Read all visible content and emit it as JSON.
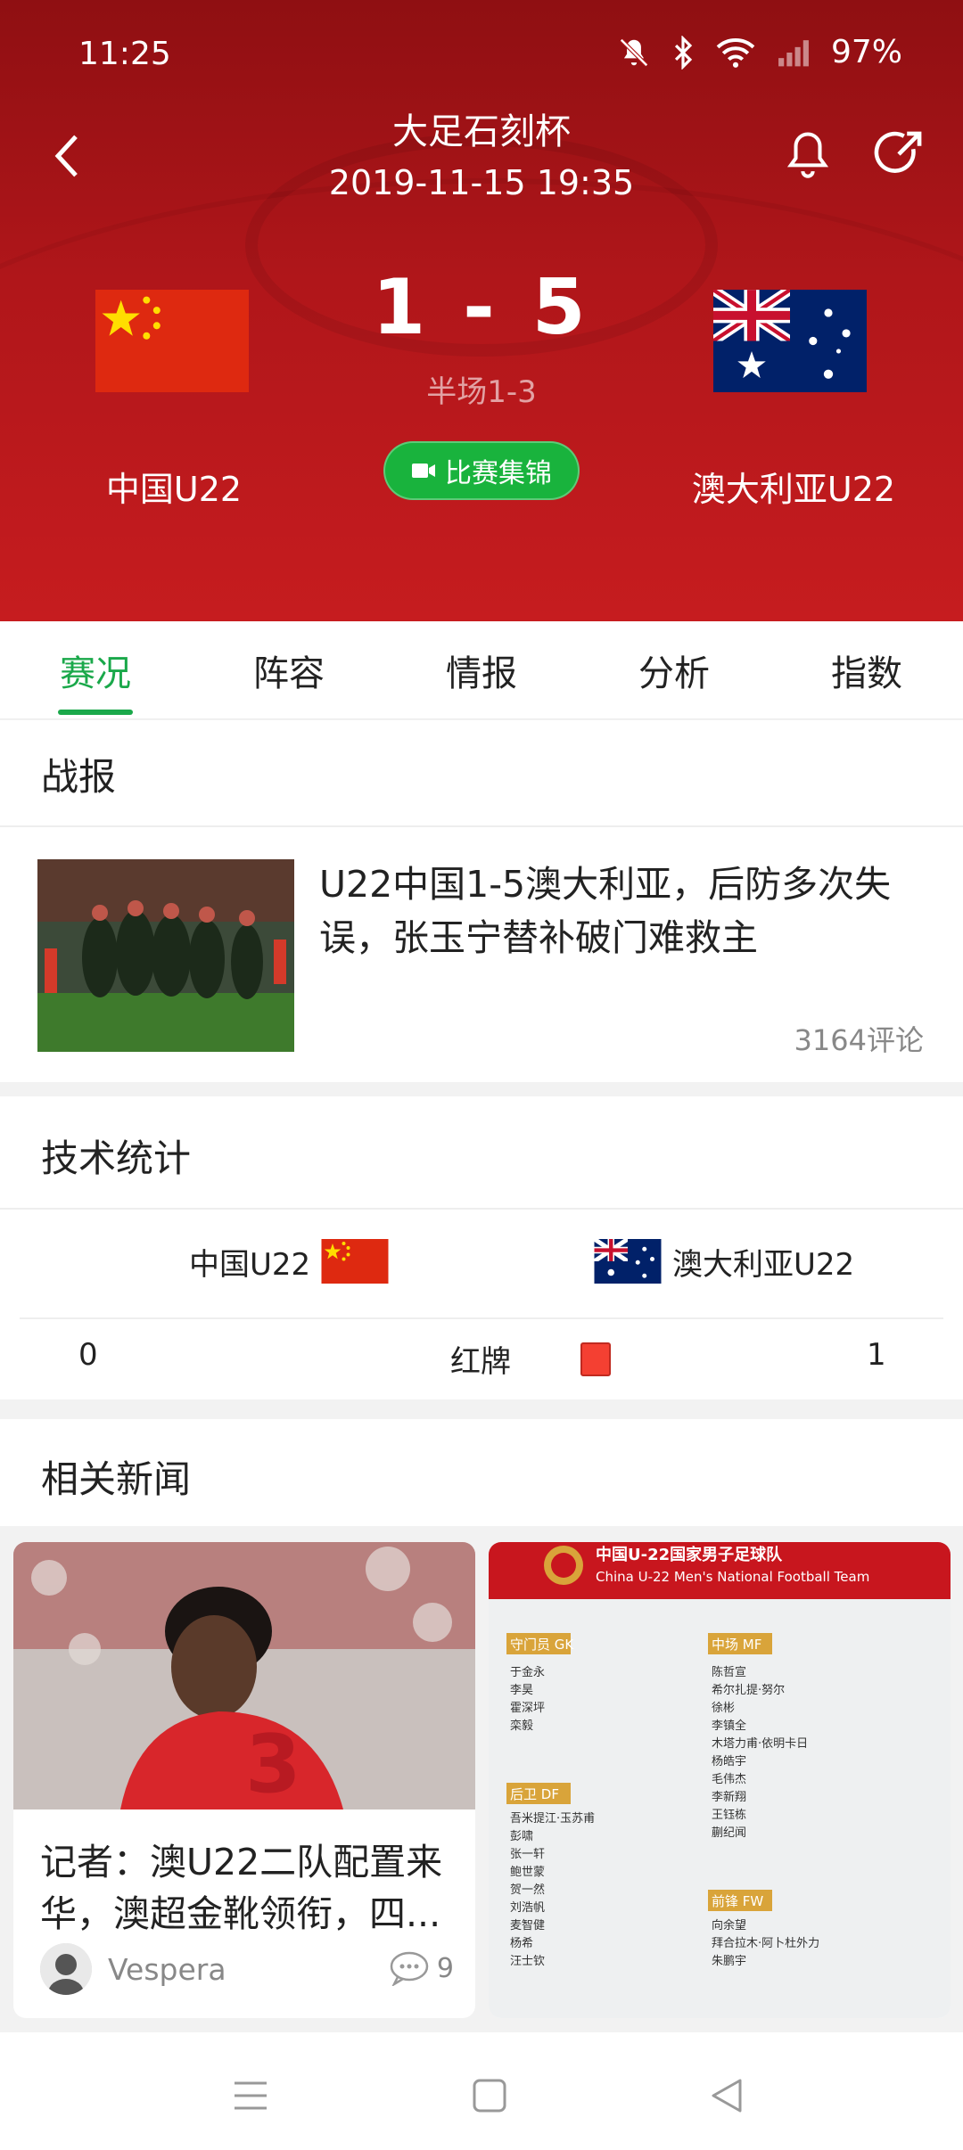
{
  "status_bar": {
    "time": "11:25",
    "battery": "97%"
  },
  "header": {
    "title": "大足石刻杯",
    "datetime": "2019-11-15 19:35",
    "score": "1 - 5",
    "halftime": "半场1-3",
    "home_team": "中国U22",
    "away_team": "澳大利亚U22",
    "highlight_label": "比赛集锦"
  },
  "tabs": [
    {
      "label": "赛况",
      "active": true
    },
    {
      "label": "阵容",
      "active": false
    },
    {
      "label": "情报",
      "active": false
    },
    {
      "label": "分析",
      "active": false
    },
    {
      "label": "指数",
      "active": false
    }
  ],
  "report": {
    "section_title": "战报",
    "headline": "U22中国1-5澳大利亚，后防多次失误，张玉宁替补破门难救主",
    "comments": "3164评论"
  },
  "stats": {
    "section_title": "技术统计",
    "home_team": "中国U22",
    "away_team": "澳大利亚U22",
    "rows": [
      {
        "label": "红牌",
        "home": "0",
        "away": "1"
      }
    ]
  },
  "related": {
    "section_title": "相关新闻",
    "cards": [
      {
        "title": "记者：澳U22二队配置来华，澳超金靴领衔，四...",
        "author": "Vespera",
        "comments": "9"
      },
      {
        "poster_title": "中国U-22国家男子足球队",
        "poster_subtitle": "China U-22 Men's National Football Team",
        "groups": [
          {
            "label": "守门员 GK",
            "names": [
              "于金永",
              "李昊",
              "霍深坪",
              "栾毅"
            ]
          },
          {
            "label": "后卫 DF",
            "names": [
              "吾米提江·玉苏甫",
              "彭啸",
              "张一轩",
              "鲍世蒙",
              "贺一然",
              "刘浩帆",
              "麦智健",
              "杨希",
              "汪士钦"
            ]
          },
          {
            "label": "中场 MF",
            "names": [
              "陈哲宣",
              "希尔扎提·努尔",
              "徐彬",
              "李镇全",
              "木塔力甫·依明卡日",
              "杨皓宇",
              "毛伟杰",
              "李新翔",
              "王钰栋",
              "蒯纪闻"
            ]
          },
          {
            "label": "前锋 FW",
            "names": [
              "向余望",
              "拜合拉木·阿卜杜外力",
              "朱鹏宇"
            ]
          }
        ]
      }
    ]
  },
  "nav": [
    "menu-button",
    "home-button",
    "back-button"
  ]
}
